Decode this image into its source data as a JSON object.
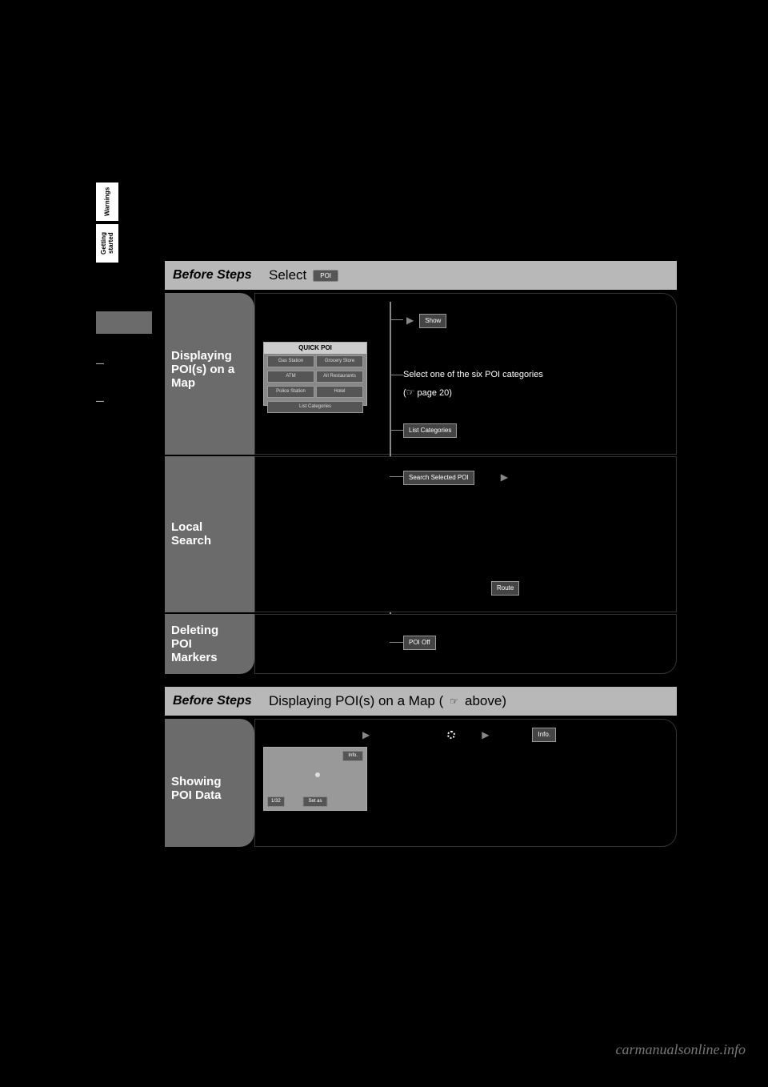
{
  "sideTabs": {
    "tab1": "Warnings",
    "tab2": "Getting started"
  },
  "sideNav": {
    "item_active": "",
    "item1": "",
    "item2": "",
    "item3": ""
  },
  "step1": {
    "label": "Before Steps",
    "desc": "Select",
    "chip": "POI"
  },
  "block1": {
    "title_l1": "Displaying",
    "title_l2": "POI(s) on a",
    "title_l3": "Map"
  },
  "quickpoi": {
    "header": "QUICK POI",
    "btn1": "Gas Station",
    "btn2": "Grocery Store",
    "btn3": "ATM",
    "btn4": "All Restaurants",
    "btn5": "Police Station",
    "btn6": "Hotel",
    "wide": "List Categories"
  },
  "flow1": {
    "showBtn": "Show",
    "line1": "Select one of the six POI categories",
    "line2": "(",
    "ref": "page 20)",
    "listCatBtn": "List Categories",
    "searchBtn": "Search Selected POI",
    "routeBtn": "Route",
    "poiOffBtn": "POI Off"
  },
  "block2": {
    "title_l1": "Local",
    "title_l2": "Search"
  },
  "block3": {
    "title_l1": "Deleting",
    "title_l2": "POI",
    "title_l3": "Markers"
  },
  "step2": {
    "label": "Before Steps",
    "desc_pre": "Displaying POI(s) on a Map (",
    "desc_post": " above)"
  },
  "block4": {
    "title_l1": "Showing",
    "title_l2": "POI Data"
  },
  "mapss": {
    "info": "Info.",
    "setas": "Set as",
    "zoom": "1/32"
  },
  "flow4": {
    "infoBtn": "Info."
  },
  "watermark": "carmanualsonline.info"
}
